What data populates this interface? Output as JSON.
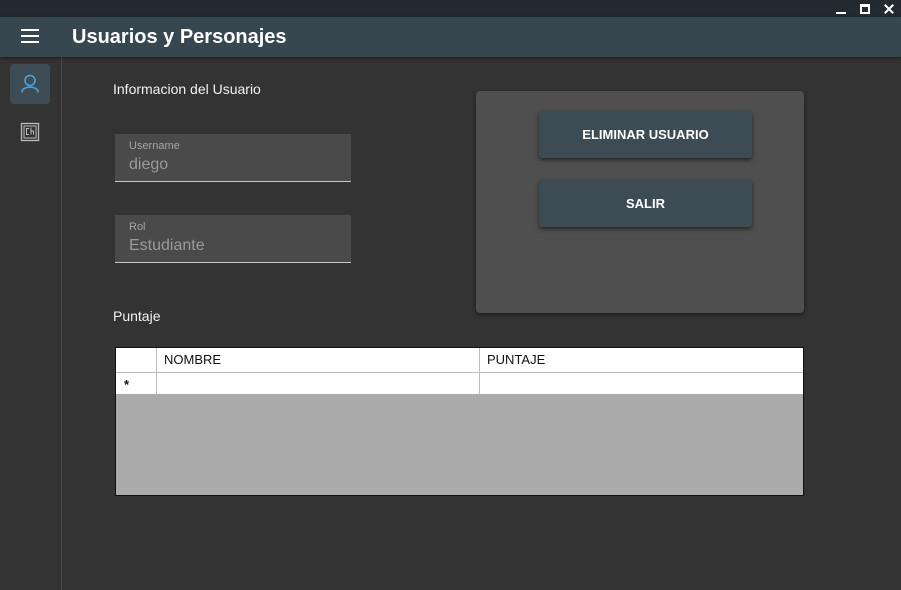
{
  "window": {
    "controls": [
      "minimize-icon",
      "maximize-icon",
      "close-icon"
    ]
  },
  "appbar": {
    "menu_icon": "hamburger-icon",
    "title": "Usuarios y Personajes",
    "color": "#37474f"
  },
  "sidebar": {
    "items": [
      {
        "icon": "user-icon",
        "active": true
      },
      {
        "icon": "characters-icon",
        "active": false
      }
    ],
    "accent": "#4aa3df"
  },
  "user_info": {
    "heading": "Informacion del Usuario",
    "username": {
      "label": "Username",
      "value": "diego"
    },
    "rol": {
      "label": "Rol",
      "value": "Estudiante"
    }
  },
  "actions": {
    "delete_label": "ELIMINAR USUARIO",
    "exit_label": "SALIR"
  },
  "scores": {
    "heading": "Puntaje",
    "columns": [
      "NOMBRE",
      "PUNTAJE"
    ],
    "new_row_marker": "*",
    "rows": []
  }
}
